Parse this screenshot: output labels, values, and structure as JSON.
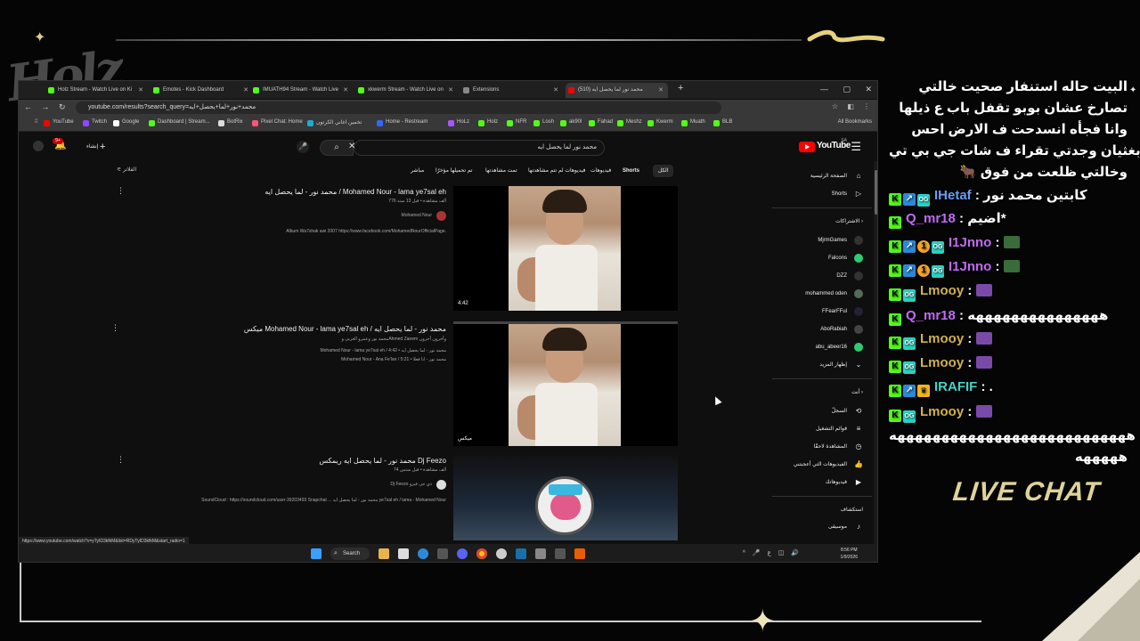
{
  "overlay": {
    "logo_text": "Holz",
    "live_chat_label": "LIVE CHAT",
    "accent_gold": "#e0d39a"
  },
  "browser": {
    "tabs": [
      {
        "label": "Holz Stream - Watch Live on Ki",
        "color": "#53fc18"
      },
      {
        "label": "Emotes - Kick Dashboard",
        "color": "#53fc18"
      },
      {
        "label": "IMUATH94 Stream - Watch Live",
        "color": "#53fc18"
      },
      {
        "label": "xkwerm Stream - Watch Live on",
        "color": "#53fc18"
      },
      {
        "label": "Extensions",
        "color": "#888888"
      },
      {
        "label": "(510) محمد نور لما يحصل ايه",
        "color": "#ff0000"
      }
    ],
    "url": "youtube.com/results?search_query=محمد+نور+لما+يحصل+ايه",
    "bookmarks": [
      {
        "label": "YouTube",
        "color": "#ff0000"
      },
      {
        "label": "Twitch",
        "color": "#9146ff"
      },
      {
        "label": "Google",
        "color": "#ffffff"
      },
      {
        "label": "Dashboard | Stream...",
        "color": "#53fc18"
      },
      {
        "label": "BotRix",
        "color": "#dddddd"
      },
      {
        "label": "Pixel Chat: Home",
        "color": "#ff5577"
      },
      {
        "label": "تخمين اغاني الكرتون",
        "color": "#22aacc"
      },
      {
        "label": "Home - Restream",
        "color": "#3366ff"
      },
      {
        "label": "HoLz",
        "color": "#aa55ff"
      },
      {
        "label": "Holz",
        "color": "#53fc18"
      },
      {
        "label": "NFR",
        "color": "#53fc18"
      },
      {
        "label": "Losh",
        "color": "#53fc18"
      },
      {
        "label": "ak90l",
        "color": "#53fc18"
      },
      {
        "label": "Fahad",
        "color": "#53fc18"
      },
      {
        "label": "Meshz",
        "color": "#53fc18"
      },
      {
        "label": "Kwerm",
        "color": "#53fc18"
      },
      {
        "label": "Muath",
        "color": "#53fc18"
      },
      {
        "label": "BLB",
        "color": "#53fc18"
      }
    ],
    "all_bookmarks": "All Bookmarks",
    "status_url": "https://www.youtube.com/watch?v=yTyID3kfkM&list=RDyTyID3kfkM&start_radio=1"
  },
  "youtube": {
    "logo": "YouTube",
    "country": "SA",
    "search_value": "محمد نور لما يحصل ايه",
    "create_label": "إنشاء",
    "notif_count": "9+",
    "chips": [
      "الكل",
      "Shorts",
      "فيديوهات",
      "فيديوهات لم تتم مشاهدتها",
      "تمت مشاهدتها",
      "تم تحميلها مؤخرًا",
      "مباشر"
    ],
    "filter_label": "الفلاتر",
    "sidebar": {
      "home": "الصفحة الرئيسية",
      "shorts": "Shorts",
      "subscriptions_head": "الاشتراكات",
      "subscriptions": [
        "MjrmGames",
        "Falcons",
        "DZZ",
        "mohammed oden",
        "FFearFFul",
        "AboRabiah",
        "abu_abeer16"
      ],
      "show_more": "إظهار المزيد",
      "you_head": "أنت",
      "you_items": [
        "السجلّ",
        "قوائم التشغيل",
        "المشاهدة لاحقًا",
        "الفيديوهات التي أعجبتني",
        "فيديوهاتك"
      ],
      "explore_head": "استكشاف",
      "explore_items": [
        "موسيقى"
      ]
    },
    "results": [
      {
        "title": "محمد نور - لما يحصل ايه / Mohamed Nour - lama ye7sal eh",
        "meta": "776 ألف مشاهدة • قبل 13 سنة",
        "channel": "Mohamed Nour",
        "desc": "Album Wa7shak awi 2007 https://www.facebook.com/MohamedNourOfficialPage.",
        "duration": "4:42"
      },
      {
        "title": "ميكس Mohamed Nour - lama ye7sal eh / محمد نور - لما يحصل ايه",
        "meta": "محمد نور وعمرو العزبي وAhmed Zaeem وآخرون آخرون",
        "desc1": "Mohamed Nour - lama ye7sal eh / محمد نور - لما يحصل ايه • 4:42",
        "desc2": "Mohamed Nour - Ana Fe'lan / 5:21 • محمد نور - انا فعلا",
        "duration": "ميكس"
      },
      {
        "title": "محمد نور - لما يحصل ايه ريمكس Dj Feezo",
        "meta": "74 ألف مشاهدة • قبل سنتين",
        "channel": "Dj Feezo دي جي فيزو",
        "desc": "SoundCloud : https://soundcloud.com/user-39203493 Snapchat ... محمد نور - لما يحصل ايه ye7sal eh / lama - Mohamed Nour"
      }
    ]
  },
  "taskbar": {
    "search": "Search",
    "time": "8:56 PM",
    "date": "1/9/2026",
    "lang": "ع"
  },
  "chat": {
    "lines": [
      {
        "kind": "text",
        "text": "البيت حاله استنفار صحيت خالتي"
      },
      {
        "kind": "text",
        "text": "تصارخ عشان بوبو تقفل باب ع ذيلها"
      },
      {
        "kind": "text",
        "text": "وانا فجأه انسدحت ف الارض احس"
      },
      {
        "kind": "text",
        "text": "بغثيان وجدتي تقراء ف شات جي بي تي"
      },
      {
        "kind": "text",
        "text": "🐂 وخالتي ظلعت من فوق"
      },
      {
        "kind": "msg",
        "badges": [
          "k",
          "up",
          "og"
        ],
        "user": "IHetaf",
        "color": "#6a9df0",
        "text": "كابتين محمد نور"
      },
      {
        "kind": "msg",
        "badges": [
          "k"
        ],
        "user": "Q_mr18",
        "color": "#c06bf5",
        "text": "اضيم*"
      },
      {
        "kind": "msg",
        "badges": [
          "k",
          "up",
          "one",
          "og"
        ],
        "user": "I1Jnno",
        "color": "#c06bf5",
        "text": ""
      },
      {
        "kind": "msg",
        "badges": [
          "k",
          "up",
          "one",
          "og"
        ],
        "user": "I1Jnno",
        "color": "#c06bf5",
        "text": ""
      },
      {
        "kind": "msg",
        "badges": [
          "k",
          "og"
        ],
        "user": "Lmooy",
        "color": "#d2b24c",
        "text": ""
      },
      {
        "kind": "msg",
        "badges": [
          "k"
        ],
        "user": "Q_mr18",
        "color": "#c06bf5",
        "text": "هههههههههههههههه"
      },
      {
        "kind": "msg",
        "badges": [
          "k",
          "og"
        ],
        "user": "Lmooy",
        "color": "#d2b24c",
        "text": ""
      },
      {
        "kind": "msg",
        "badges": [
          "k",
          "og"
        ],
        "user": "Lmooy",
        "color": "#d2b24c",
        "text": ""
      },
      {
        "kind": "msg",
        "badges": [
          "k",
          "up",
          "crown"
        ],
        "user": "IRAFIF",
        "color": "#47d1c7",
        "text": "."
      },
      {
        "kind": "msg",
        "badges": [
          "k",
          "og"
        ],
        "user": "Lmooy",
        "color": "#d2b24c",
        "text": ""
      },
      {
        "kind": "text",
        "text": "هههههههههههههههههههههههههههه"
      },
      {
        "kind": "text",
        "text": "هههههه"
      }
    ]
  }
}
